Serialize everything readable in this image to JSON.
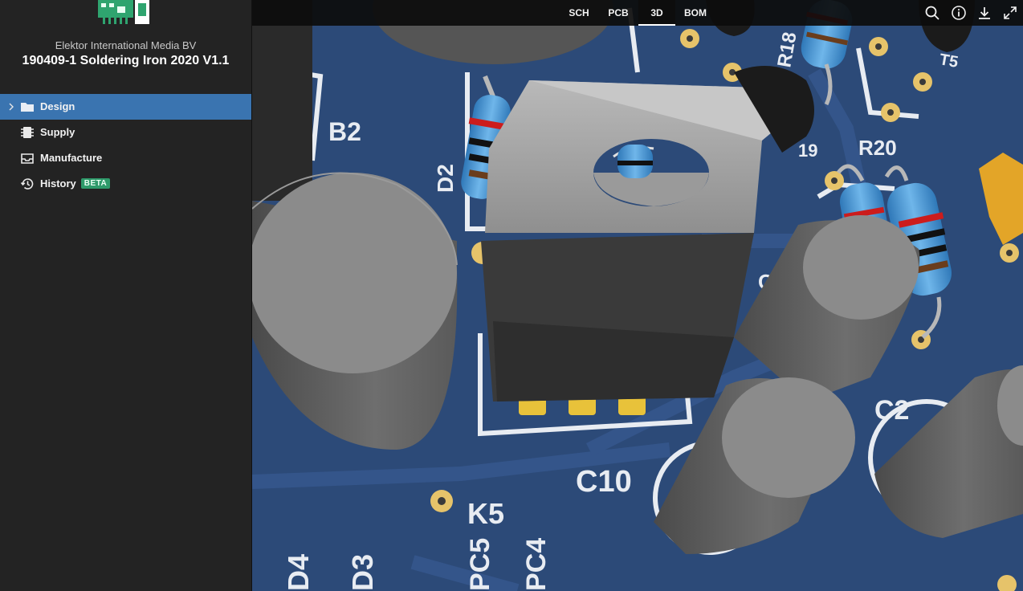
{
  "sidebar": {
    "org": "Elektor International Media BV",
    "project_title": "190409-1 Soldering Iron 2020 V1.1",
    "items": [
      {
        "label": "Design",
        "icon": "folder-icon",
        "active": true
      },
      {
        "label": "Supply",
        "icon": "chip-icon",
        "active": false
      },
      {
        "label": "Manufacture",
        "icon": "inbox-icon",
        "active": false
      },
      {
        "label": "History",
        "icon": "history-icon",
        "active": false,
        "badge": "BETA"
      }
    ]
  },
  "viewer": {
    "tabs": [
      {
        "label": "SCH",
        "active": false
      },
      {
        "label": "PCB",
        "active": false
      },
      {
        "label": "3D",
        "active": true
      },
      {
        "label": "BOM",
        "active": false
      }
    ],
    "tools": [
      "search-icon",
      "info-icon",
      "download-icon",
      "fullscreen-icon"
    ],
    "silkscreen": {
      "b2": "B2",
      "d2": "D2",
      "r18": "R18",
      "r20": "R20",
      "c2": "C2",
      "c10": "C10",
      "k5": "K5",
      "d4": "D4",
      "d3": "D3",
      "pc5": "PC5",
      "pc4": "PC4",
      "t5": "T5",
      "r19": "19",
      "c5": "C5"
    },
    "colors": {
      "board": "#2c4a78",
      "accent": "#3a74b0",
      "badge": "#2e9a6a"
    }
  }
}
